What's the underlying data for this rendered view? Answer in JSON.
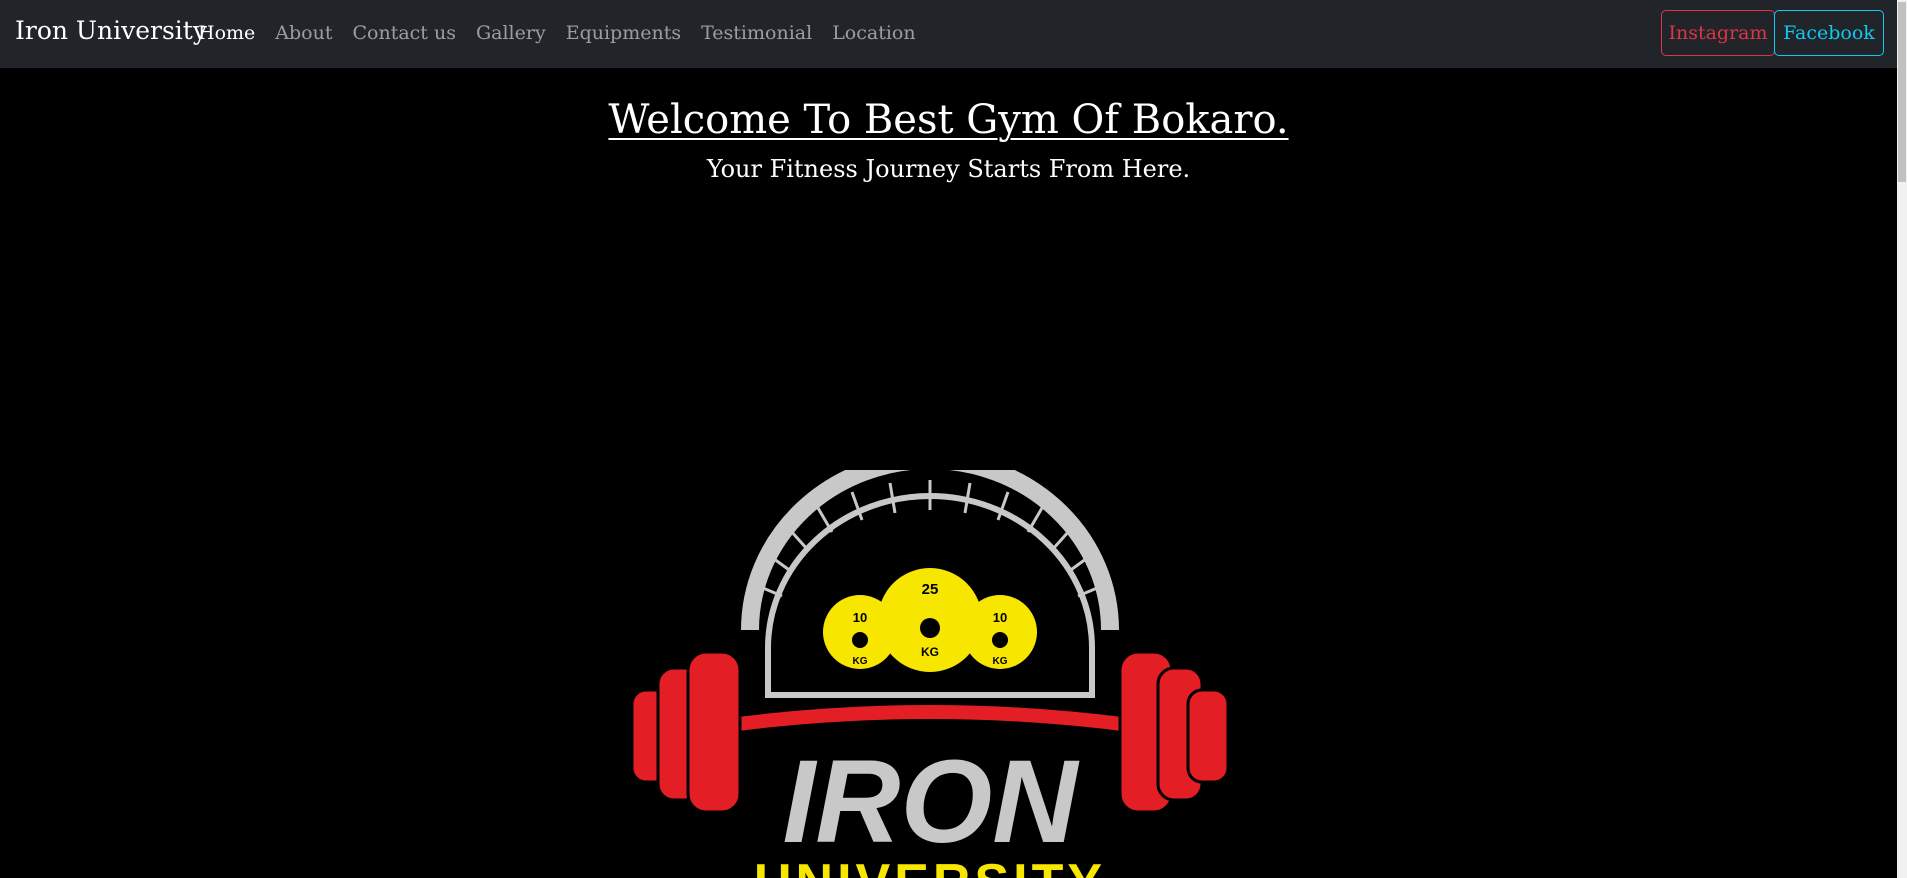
{
  "navbar": {
    "brand": "Iron University",
    "links": [
      {
        "label": "Home",
        "active": true
      },
      {
        "label": "About",
        "active": false
      },
      {
        "label": "Contact us",
        "active": false
      },
      {
        "label": "Gallery",
        "active": false
      },
      {
        "label": "Equipments",
        "active": false
      },
      {
        "label": "Testimonial",
        "active": false
      },
      {
        "label": "Location",
        "active": false
      }
    ],
    "buttons": {
      "instagram": "Instagram",
      "facebook": "Facebook"
    }
  },
  "hero": {
    "title": "Welcome To Best Gym Of Bokaro.",
    "subtitle": "Your Fitness Journey Starts From Here."
  },
  "logo": {
    "plate_left": "10",
    "plate_center": "25",
    "plate_right": "10",
    "plate_unit": "KG",
    "word_top": "IRON",
    "word_bottom": "UNIVERSITY"
  },
  "colors": {
    "nav_bg": "#212529",
    "page_bg": "#000000",
    "instagram": "#dc3545",
    "facebook": "#0dcaf0",
    "logo_red": "#e31e24",
    "logo_yellow": "#f7e600",
    "logo_silver": "#c8c8c8"
  }
}
